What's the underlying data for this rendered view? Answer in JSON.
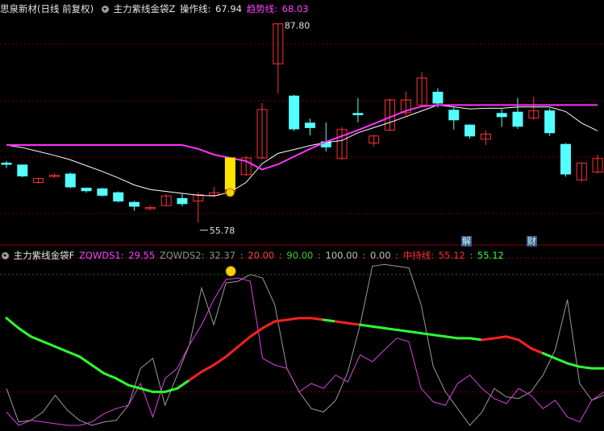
{
  "header": {
    "title": "思泉新材(日线 前复权)",
    "indicator1_name": "主力紫线金袋Z",
    "op_label": "操作线:",
    "op_value": "67.94",
    "trend_label": "趋势线:",
    "trend_value": "68.03"
  },
  "subheader": {
    "indicator2_name": "主力紫线金袋F",
    "zq1_label": "ZQWDS1:",
    "zq1_value": "29.55",
    "zq2_label": "ZQWDS2:",
    "zq2_value": "32.37",
    "v20": "20.00",
    "v90": "90.00",
    "v100": "100.00",
    "v0": "0.00",
    "hold_label": "中持线:",
    "hold_value": "55.12",
    "hold_value2": "55.12"
  },
  "annotations": {
    "high_label": "87.80",
    "low_label": "55.78",
    "badge1": "解",
    "badge2": "财"
  },
  "colors": {
    "up": "#ff3232",
    "down": "#54ffff",
    "trend": "#ff32ff",
    "ma": "#ffffff",
    "hold_red": "#ff2020",
    "hold_green": "#30ff30"
  },
  "chart_data": [
    {
      "type": "candlestick",
      "ylim": [
        54,
        89
      ],
      "candles": [
        {
          "o": 66.2,
          "c": 66.0,
          "h": 66.5,
          "l": 65.4
        },
        {
          "o": 65.9,
          "c": 64.2,
          "h": 66.0,
          "l": 64.0
        },
        {
          "o": 63.2,
          "c": 63.8,
          "h": 63.9,
          "l": 63.0
        },
        {
          "o": 64.1,
          "c": 64.3,
          "h": 64.6,
          "l": 63.9
        },
        {
          "o": 64.5,
          "c": 62.5,
          "h": 64.7,
          "l": 62.3
        },
        {
          "o": 62.3,
          "c": 61.9,
          "h": 62.4,
          "l": 61.6
        },
        {
          "o": 62.2,
          "c": 61.2,
          "h": 62.4,
          "l": 61.0
        },
        {
          "o": 61.6,
          "c": 60.3,
          "h": 61.8,
          "l": 60.1
        },
        {
          "o": 60.1,
          "c": 59.5,
          "h": 60.3,
          "l": 58.8
        },
        {
          "o": 59.2,
          "c": 59.3,
          "h": 59.6,
          "l": 58.9
        },
        {
          "o": 59.6,
          "c": 61.1,
          "h": 61.4,
          "l": 59.5
        },
        {
          "o": 60.7,
          "c": 59.9,
          "h": 61.5,
          "l": 59.5
        },
        {
          "o": 60.3,
          "c": 61.3,
          "h": 61.7,
          "l": 57.0
        },
        {
          "o": 61.2,
          "c": 61.6,
          "h": 62.5,
          "l": 61.0
        },
        {
          "o": 61.8,
          "c": 62.9,
          "h": 63.1,
          "l": 61.7
        },
        {
          "o": 64.4,
          "c": 67.0,
          "h": 67.3,
          "l": 64.2
        },
        {
          "o": 67.0,
          "c": 74.5,
          "h": 75.5,
          "l": 66.8
        },
        {
          "o": 81.6,
          "c": 87.8,
          "h": 87.8,
          "l": 77.0
        },
        {
          "o": 76.6,
          "c": 71.5,
          "h": 76.8,
          "l": 71.2
        },
        {
          "o": 72.4,
          "c": 71.7,
          "h": 73.1,
          "l": 70.5
        },
        {
          "o": 69.5,
          "c": 68.7,
          "h": 72.5,
          "l": 68.0
        },
        {
          "o": 66.9,
          "c": 71.4,
          "h": 71.8,
          "l": 66.7
        },
        {
          "o": 73.9,
          "c": 73.7,
          "h": 76.3,
          "l": 72.5
        },
        {
          "o": 69.3,
          "c": 70.4,
          "h": 70.6,
          "l": 68.8
        },
        {
          "o": 71.3,
          "c": 76.0,
          "h": 76.2,
          "l": 71.2
        },
        {
          "o": 74.0,
          "c": 76.0,
          "h": 77.3,
          "l": 73.4
        },
        {
          "o": 75.2,
          "c": 79.4,
          "h": 80.3,
          "l": 75.0
        },
        {
          "o": 77.2,
          "c": 75.5,
          "h": 77.8,
          "l": 74.8
        },
        {
          "o": 74.4,
          "c": 72.9,
          "h": 74.8,
          "l": 71.4
        },
        {
          "o": 72.1,
          "c": 70.4,
          "h": 72.2,
          "l": 70.0
        },
        {
          "o": 69.9,
          "c": 70.7,
          "h": 71.3,
          "l": 69.0
        },
        {
          "o": 73.9,
          "c": 73.4,
          "h": 74.6,
          "l": 71.8
        },
        {
          "o": 74.1,
          "c": 71.9,
          "h": 76.3,
          "l": 71.5
        },
        {
          "o": 73.2,
          "c": 74.3,
          "h": 76.5,
          "l": 72.9
        },
        {
          "o": 74.3,
          "c": 70.9,
          "h": 74.7,
          "l": 70.4
        },
        {
          "o": 69.1,
          "c": 64.5,
          "h": 69.3,
          "l": 64.1
        },
        {
          "o": 63.6,
          "c": 66.2,
          "h": 66.3,
          "l": 63.3
        },
        {
          "o": 64.8,
          "c": 66.9,
          "h": 67.5,
          "l": 64.6
        }
      ],
      "trend_line": [
        69.0,
        69.0,
        69.0,
        69.0,
        69.0,
        69.0,
        69.0,
        69.0,
        69.0,
        69.0,
        69.0,
        69.0,
        68.4,
        67.5,
        67.0,
        66.5,
        65.2,
        66.0,
        67.2,
        68.4,
        69.5,
        70.4,
        71.3,
        72.3,
        73.3,
        74.3,
        75.0,
        75.2,
        75.2,
        75.2,
        75.2,
        75.2,
        75.2,
        75.2,
        75.2,
        75.2,
        75.2,
        75.2
      ],
      "ma_line": [
        69.0,
        68.6,
        68.0,
        67.4,
        66.7,
        65.8,
        64.9,
        63.9,
        62.8,
        62.1,
        61.8,
        61.5,
        61.2,
        61.1,
        61.7,
        63.2,
        66.1,
        67.7,
        68.3,
        68.9,
        69.4,
        69.7,
        70.9,
        71.7,
        72.5,
        73.4,
        74.3,
        75.2,
        74.9,
        74.6,
        74.7,
        74.7,
        74.9,
        74.9,
        74.9,
        74.2,
        72.4,
        71.2
      ],
      "labels": [
        "87.80",
        "55.78"
      ]
    },
    {
      "type": "line",
      "ylim": [
        0,
        100
      ],
      "ref_lines": [
        20,
        90,
        100,
        0
      ],
      "series": [
        {
          "name": "ZQWDS1",
          "values": [
            8,
            0,
            3,
            2,
            1,
            0,
            0,
            2,
            7,
            10,
            12,
            25,
            5,
            28,
            34,
            48,
            60,
            75,
            87,
            88,
            86,
            40,
            36,
            34,
            20,
            25,
            22,
            30,
            26,
            42,
            38,
            45,
            52,
            50,
            22,
            14,
            12,
            25,
            30,
            22,
            16,
            13,
            22,
            18,
            10,
            15,
            5,
            2,
            15,
            20
          ]
        },
        {
          "name": "ZQWDS2",
          "values": [
            22,
            2,
            3,
            8,
            18,
            9,
            3,
            0,
            2,
            3,
            12,
            34,
            40,
            12,
            30,
            48,
            82,
            60,
            85,
            86,
            90,
            88,
            72,
            34,
            20,
            10,
            8,
            15,
            32,
            60,
            95,
            96,
            95,
            94,
            72,
            35,
            20,
            10,
            0,
            8,
            22,
            17,
            16,
            20,
            30,
            45,
            75,
            25,
            15,
            18
          ]
        },
        {
          "name": "中持线",
          "values": [
            64,
            58,
            53,
            50,
            47,
            44,
            41,
            36,
            31,
            28,
            24,
            22,
            20,
            20,
            22,
            27,
            32,
            36,
            41,
            47,
            53,
            58,
            62,
            63,
            64,
            64,
            63,
            62,
            61,
            60,
            59,
            58,
            57,
            56,
            55,
            54,
            53,
            52,
            52,
            51,
            52,
            53,
            51,
            46,
            43,
            40,
            37,
            35,
            34,
            34
          ]
        }
      ],
      "hold_colors": [
        "g",
        "g",
        "g",
        "g",
        "g",
        "g",
        "g",
        "g",
        "g",
        "g",
        "g",
        "g",
        "g",
        "g",
        "g",
        "r",
        "r",
        "r",
        "r",
        "r",
        "r",
        "r",
        "r",
        "r",
        "r",
        "r",
        "g",
        "r",
        "r",
        "g",
        "g",
        "g",
        "g",
        "g",
        "g",
        "g",
        "g",
        "g",
        "g",
        "r",
        "r",
        "r",
        "r",
        "r",
        "g",
        "g",
        "g",
        "g",
        "g",
        "g"
      ]
    }
  ]
}
